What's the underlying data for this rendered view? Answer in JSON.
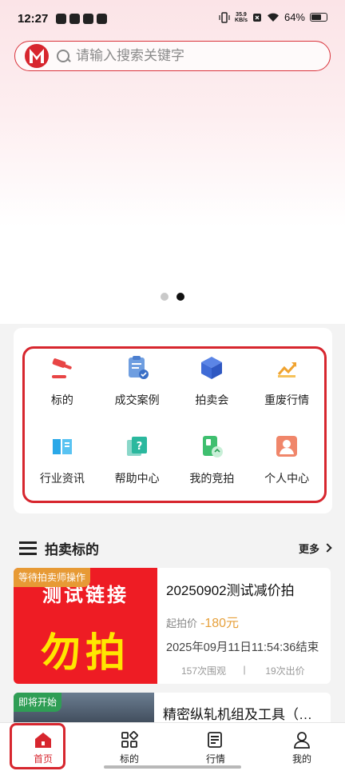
{
  "status_bar": {
    "time": "12:27",
    "net_speed": "35.9",
    "net_unit": "KB/s",
    "battery": "64%"
  },
  "search": {
    "placeholder": "请输入搜索关键字"
  },
  "banner": {
    "dots": 2,
    "active_index": 1
  },
  "menu": {
    "items": [
      {
        "label": "标的",
        "icon": "gavel-icon"
      },
      {
        "label": "成交案例",
        "icon": "clipboard-check-icon"
      },
      {
        "label": "拍卖会",
        "icon": "cube-icon"
      },
      {
        "label": "重废行情",
        "icon": "trend-chart-icon"
      },
      {
        "label": "行业资讯",
        "icon": "book-icon"
      },
      {
        "label": "帮助中心",
        "icon": "help-question-icon"
      },
      {
        "label": "我的竞拍",
        "icon": "my-bid-icon"
      },
      {
        "label": "个人中心",
        "icon": "person-icon"
      }
    ]
  },
  "section": {
    "title": "拍卖标的",
    "more": "更多"
  },
  "items": [
    {
      "tag": "等待拍卖师操作",
      "thumb_line1": "测试链接",
      "thumb_line2": "勿拍",
      "title": "20250902测试减价拍",
      "price_label": "起拍价",
      "price": "-180元",
      "end_time": "2025年09月11日11:54:36结束",
      "views": "157次围观",
      "sep": "|",
      "bids": "19次出价"
    },
    {
      "tag": "即将开始",
      "title": "精密纵轧机组及工具（…"
    }
  ],
  "bottom_nav": {
    "items": [
      {
        "label": "首页"
      },
      {
        "label": "标的"
      },
      {
        "label": "行情"
      },
      {
        "label": "我的"
      }
    ]
  },
  "colors": {
    "accent": "#d7262e",
    "price": "#e6a03b",
    "tag_orange": "#e79a35",
    "tag_green": "#2f9e55"
  }
}
